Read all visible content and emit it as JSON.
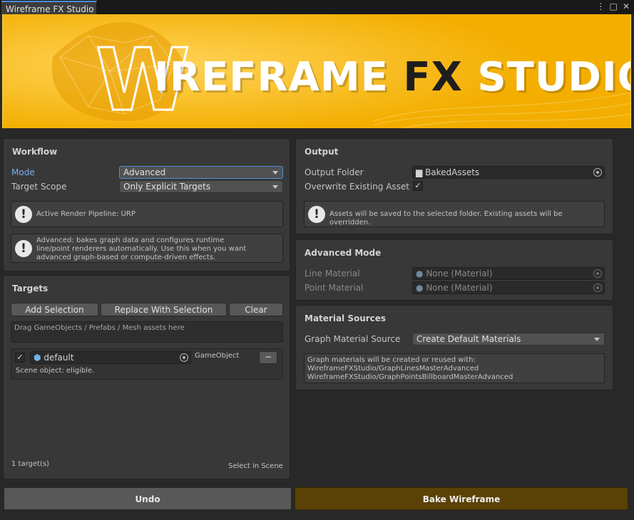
{
  "window": {
    "tab_title": "Wireframe FX Studio",
    "menu_icon": "kebab-menu-icon",
    "maximize_icon": "maximize-icon",
    "close_icon": "close-icon"
  },
  "banner": {
    "logo_letter": "W",
    "title_part1": "IREFRAME ",
    "title_part2": "FX",
    "title_part3": " STUDIO",
    "colors": {
      "background": "#f5b400",
      "text": "#ffffff",
      "fx": "#1e1e1e"
    }
  },
  "workflow": {
    "title": "Workflow",
    "mode_label": "Mode",
    "mode_value": "Advanced",
    "target_scope_label": "Target Scope",
    "target_scope_value": "Only Explicit Targets",
    "pipeline_help": "Active Render Pipeline: URP",
    "advanced_help": "Advanced: bakes graph data and configures runtime line/point renderers automatically. Use this when you want advanced graph-based or compute-driven effects."
  },
  "targets": {
    "title": "Targets",
    "add_selection": "Add Selection",
    "replace_with_selection": "Replace With Selection",
    "clear": "Clear",
    "dropzone_text": "Drag GameObjects / Prefabs / Mesh assets here",
    "items": [
      {
        "checked": true,
        "name": "default",
        "type": "GameObject",
        "status": "Scene object: eligible.",
        "remove_label": "−"
      }
    ],
    "count_text": "1 target(s)",
    "select_in_scene": "Select in Scene"
  },
  "output": {
    "title": "Output",
    "folder_label": "Output Folder",
    "folder_value": "BakedAssets",
    "overwrite_label": "Overwrite Existing Asset",
    "overwrite_checked": true,
    "help": "Assets will be saved to the selected folder. Existing assets will be overridden."
  },
  "advanced_mode": {
    "title": "Advanced Mode",
    "line_material_label": "Line Material",
    "line_material_value": "None (Material)",
    "point_material_label": "Point Material",
    "point_material_value": "None (Material)"
  },
  "material_sources": {
    "title": "Material Sources",
    "source_label": "Graph Material Source",
    "source_value": "Create Default Materials",
    "info_line1": "Graph materials will be created or reused with:",
    "info_line2": "WireframeFXStudio/GraphLinesMasterAdvanced",
    "info_line3": "WireframeFXStudio/GraphPointsBillboardMasterAdvanced"
  },
  "actions": {
    "undo": "Undo",
    "bake": "Bake Wireframe",
    "bake_color": "#5a4206"
  }
}
